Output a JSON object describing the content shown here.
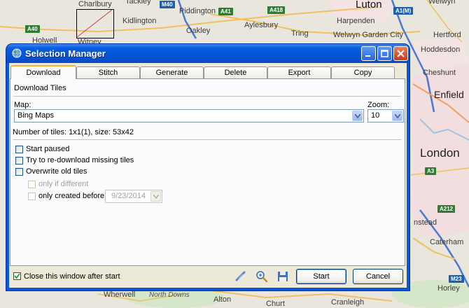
{
  "map": {
    "places": [
      {
        "id": "charlbury",
        "text": "Charlbury"
      },
      {
        "id": "tackley",
        "text": "Tackley"
      },
      {
        "id": "piddington",
        "text": "Piddington"
      },
      {
        "id": "luton",
        "text": "Luton"
      },
      {
        "id": "welwyn",
        "text": "Welwyn"
      },
      {
        "id": "kidlington",
        "text": "Kidlington"
      },
      {
        "id": "harpenden",
        "text": "Harpenden"
      },
      {
        "id": "oakley",
        "text": "Oakley"
      },
      {
        "id": "aylesbury",
        "text": "Aylesbury"
      },
      {
        "id": "welwyn-gc",
        "text": "Welwyn Garden City"
      },
      {
        "id": "hertford",
        "text": "Hertford"
      },
      {
        "id": "holwell",
        "text": "Holwell"
      },
      {
        "id": "witney",
        "text": "Witney"
      },
      {
        "id": "tring",
        "text": "Tring"
      },
      {
        "id": "hoddesdon",
        "text": "Hoddesdon"
      },
      {
        "id": "cheshunt",
        "text": "Cheshunt"
      },
      {
        "id": "enfield",
        "text": "Enfield"
      },
      {
        "id": "london",
        "text": "London"
      },
      {
        "id": "instead",
        "text": "nstead"
      },
      {
        "id": "caterham",
        "text": "Caterham"
      },
      {
        "id": "horley",
        "text": "Horley"
      },
      {
        "id": "north-downs",
        "text": "North Downs"
      },
      {
        "id": "alton",
        "text": "Alton"
      },
      {
        "id": "churt",
        "text": "Churt"
      },
      {
        "id": "cranleigh",
        "text": "Cranleigh"
      },
      {
        "id": "wherwell",
        "text": "Wherwell"
      }
    ],
    "shields": [
      {
        "id": "m40",
        "text": "M40",
        "color": "blue"
      },
      {
        "id": "a41",
        "text": "A41",
        "color": "green"
      },
      {
        "id": "a418",
        "text": "A418",
        "color": "green"
      },
      {
        "id": "a1m",
        "text": "A1(M)",
        "color": "blue"
      },
      {
        "id": "a40",
        "text": "A40",
        "color": "green"
      },
      {
        "id": "a3",
        "text": "A3",
        "color": "green"
      },
      {
        "id": "a212",
        "text": "A212",
        "color": "green"
      },
      {
        "id": "m23",
        "text": "M23",
        "color": "blue"
      }
    ]
  },
  "window": {
    "title": "Selection Manager"
  },
  "tabs": [
    "Download",
    "Stitch",
    "Generate",
    "Delete",
    "Export",
    "Copy"
  ],
  "download": {
    "section_title": "Download Tiles",
    "map_label": "Map:",
    "map_value": "Bing Maps",
    "zoom_label": "Zoom:",
    "zoom_value": "10",
    "tiles_info": "Number of tiles: 1x1(1), size: 53x42",
    "options": {
      "start_paused": "Start paused",
      "redownload_missing": "Try to re-download missing tiles",
      "overwrite_old": "Overwrite old tiles",
      "only_if_different": "only if different",
      "only_created_before": "only created before",
      "date_value": "9/23/2014"
    }
  },
  "footer": {
    "close_after_start": "Close this window after start",
    "close_after_start_checked": true,
    "start_label": "Start",
    "cancel_label": "Cancel"
  },
  "icons": {
    "title_icon": "globe-icon",
    "link": "link-icon",
    "zoom": "zoom-icon",
    "save": "save-icon"
  }
}
